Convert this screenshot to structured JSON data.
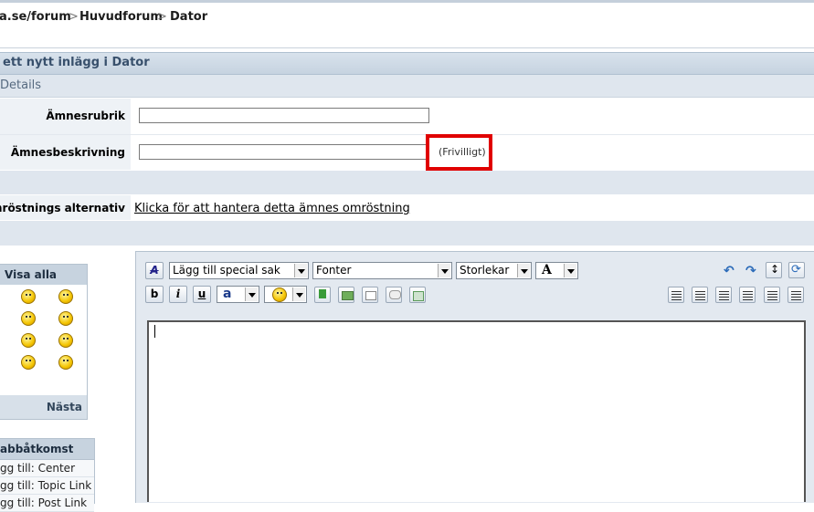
{
  "breadcrumb": {
    "site": "a.se/forum",
    "sep1": ">",
    "forum": "Huvudforum",
    "sep2": ">",
    "subforum": "Dator"
  },
  "form": {
    "title": "ett nytt inlägg i Dator",
    "details_header": "Details",
    "subject_label": "Ämnesrubrik",
    "subject_value": "",
    "description_label": "Ämnesbeskrivning",
    "description_value": "",
    "optional_note": "(Frivilligt)",
    "poll_label": "mröstnings alternativ",
    "poll_link": "Klicka för att hantera detta ämnes omröstning"
  },
  "smilies": {
    "show_all": "Visa alla",
    "next": "Nästa",
    "icons": [
      "shocked-smiley-icon",
      "smile-smiley-icon",
      "happy-smiley-icon",
      "laugh-smiley-icon",
      "cool-smiley-icon",
      "sleepy-smiley-icon",
      "angry-smiley-icon",
      "sad-smiley-icon"
    ]
  },
  "quick_access": {
    "header": "abbåtkomst",
    "items": [
      "gg till: Center",
      "gg till: Topic Link",
      "gg till: Post Link"
    ]
  },
  "editor": {
    "special_select": "Lägg till special sak",
    "font_select": "Fonter",
    "size_select": "Storlekar",
    "color_glyph": "A",
    "bold": "b",
    "italic": "i",
    "underline": "u",
    "text_style": "a"
  },
  "colors": {
    "header_bg": "#c6d3e0",
    "highlight_red": "#e00000"
  }
}
